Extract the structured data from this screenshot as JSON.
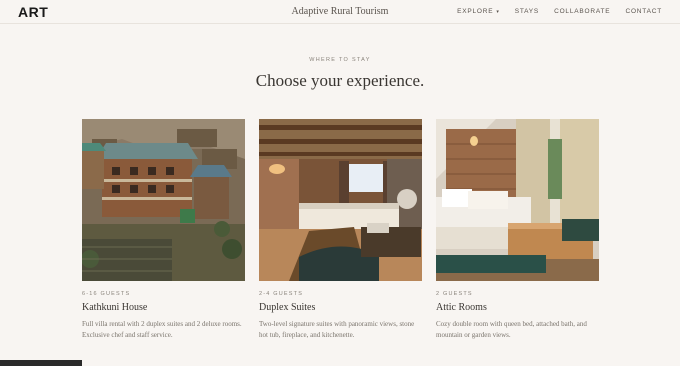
{
  "header": {
    "logo": "ART",
    "site_title": "Adaptive Rural Tourism",
    "nav": [
      {
        "label": "EXPLORE",
        "has_dropdown": true
      },
      {
        "label": "STAYS"
      },
      {
        "label": "COLLABORATE"
      },
      {
        "label": "CONTACT"
      }
    ]
  },
  "section": {
    "eyebrow": "WHERE TO STAY",
    "heading": "Choose your experience."
  },
  "cards": [
    {
      "guests": "6-16 GUESTS",
      "title": "Kathkuni House",
      "description": "Full villa rental with 2 duplex suites and 2 deluxe rooms. Exclusive chef and staff service.",
      "image": "hillside-village-photo"
    },
    {
      "guests": "2-4 GUESTS",
      "title": "Duplex Suites",
      "description": "Two-level signature suites with panoramic views, stone hot tub, fireplace, and kitchenette.",
      "image": "duplex-suite-bedroom-photo"
    },
    {
      "guests": "2 GUESTS",
      "title": "Attic Rooms",
      "description": "Cozy double room with queen bed, attached bath, and mountain or garden views.",
      "image": "attic-room-bedroom-photo"
    }
  ]
}
